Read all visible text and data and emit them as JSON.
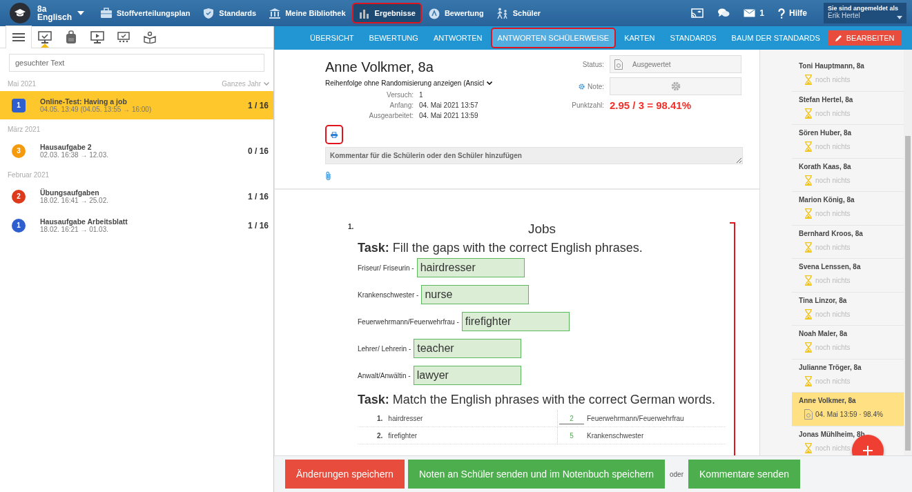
{
  "top_nav": {
    "class_menu": {
      "line1": "8a",
      "line2": "Englisch"
    },
    "items": [
      {
        "label": "Stoffverteilungsplan",
        "selected": false,
        "marked": false
      },
      {
        "label": "Standards",
        "selected": false,
        "marked": false
      },
      {
        "label": "Meine Bibliothek",
        "selected": false,
        "marked": false
      },
      {
        "label": "Ergebnisse",
        "selected": true,
        "marked": true
      },
      {
        "label": "Bewertung",
        "selected": false,
        "marked": false
      },
      {
        "label": "Schüler",
        "selected": false,
        "marked": false
      }
    ],
    "messages_count": "1",
    "help": "Hilfe",
    "user": {
      "caption": "Sie sind angemeldet als",
      "name": "Erik Hertel"
    }
  },
  "left_toolbar": [
    {
      "selected": true,
      "pointer": false
    },
    {
      "selected": false,
      "pointer": true
    },
    {
      "selected": false,
      "pointer": false
    },
    {
      "selected": false,
      "pointer": false
    },
    {
      "selected": false,
      "pointer": false
    },
    {
      "selected": false,
      "pointer": false
    }
  ],
  "search": {
    "placeholder": "gesuchter Text"
  },
  "period_filter": "Ganzes Jahr",
  "groups": [
    {
      "heading": "Mai 2021",
      "items": [
        {
          "badge": "1",
          "color": "#2f5fcf",
          "kind": "square",
          "title": "Online-Test: Having a job",
          "subtitle": "04.05. 13:49 (04.05. 13:55 → 16:00)",
          "count": "1 / 16",
          "selected": true
        }
      ]
    },
    {
      "heading": "März 2021",
      "items": [
        {
          "badge": "3",
          "color": "#f59a0c",
          "kind": "circle",
          "title": "Hausaufgabe 2",
          "subtitle": "02.03. 16:38 → 12.03.",
          "count": "0 / 16",
          "selected": false
        }
      ]
    },
    {
      "heading": "Februar 2021",
      "items": [
        {
          "badge": "2",
          "color": "#dd3a1c",
          "kind": "circle",
          "title": "Übungsaufgaben",
          "subtitle": "18.02. 16:41 → 25.02.",
          "count": "1 / 16",
          "selected": false
        },
        {
          "badge": "1",
          "color": "#2f5fcf",
          "kind": "circle",
          "title": "Hausaufgabe Arbeitsblatt",
          "subtitle": "18.02. 16:21 → 01.03.",
          "count": "1 / 16",
          "selected": false
        }
      ]
    }
  ],
  "sub_nav": {
    "tabs": [
      {
        "label": "ÜBERSICHT",
        "selected": false,
        "marked": false
      },
      {
        "label": "BEWERTUNG",
        "selected": false,
        "marked": false
      },
      {
        "label": "ANTWORTEN",
        "selected": false,
        "marked": false
      },
      {
        "label": "ANTWORTEN SCHÜLERWEISE",
        "selected": true,
        "marked": true
      },
      {
        "label": "KARTEN",
        "selected": false,
        "marked": false
      },
      {
        "label": "STANDARDS",
        "selected": false,
        "marked": false
      },
      {
        "label": "BAUM DER STANDARDS",
        "selected": false,
        "marked": false
      }
    ],
    "edit_button": "BEARBEITEN"
  },
  "result": {
    "student": "Anne Volkmer, 8a",
    "order_select": "Reihenfolge ohne Randomisierung anzeigen (Ansicl",
    "info": [
      {
        "label": "Versuch:",
        "value": "1"
      },
      {
        "label": "Anfang:",
        "value": "04. Mai 2021 13:57"
      },
      {
        "label": "Ausgearbeitet:",
        "value": "04. Mai 2021 13:59"
      }
    ],
    "print_marked": true,
    "status_label": "Status:",
    "status": "Ausgewertet",
    "grade_label": "Note:",
    "score_label": "Punktzahl:",
    "score": "2.95 / 3 = 98.41%",
    "comment_placeholder": "Kommentar für die Schülerin oder den Schüler hinzufügen"
  },
  "question": {
    "number": "1.",
    "title": "Jobs",
    "task1": "**Task:** Fill the gaps with the correct English phrases.",
    "gaps": [
      {
        "label": "Friseur/ Friseurin -",
        "value": "hairdresser"
      },
      {
        "label": "Krankenschwester -",
        "value": "nurse"
      },
      {
        "label": "Feuerwehrmann/Feuerwehrfrau -",
        "value": "firefighter"
      },
      {
        "label": "Lehrer/ Lehrerin -",
        "value": "teacher"
      },
      {
        "label": "Anwalt/Anwältin -",
        "value": "lawyer"
      }
    ],
    "task2": "**Task:** Match the English phrases with the correct German words.",
    "matches": [
      {
        "number": "1.",
        "english": "hairdresser",
        "answer": "2",
        "german": "Feuerwehrmann/Feuerwehrfrau"
      },
      {
        "number": "2.",
        "english": "firefighter",
        "answer": "5",
        "german": "Krankenschwester"
      }
    ]
  },
  "students": [
    {
      "name": "Toni Hauptmann, 8a",
      "status": "noch nichts",
      "kind": "pending",
      "selected": false
    },
    {
      "name": "Stefan Hertel, 8a",
      "status": "noch nichts",
      "kind": "pending",
      "selected": false
    },
    {
      "name": "Sören Huber, 8a",
      "status": "noch nichts",
      "kind": "pending",
      "selected": false
    },
    {
      "name": "Korath Kaas, 8a",
      "status": "noch nichts",
      "kind": "pending",
      "selected": false
    },
    {
      "name": "Marion König, 8a",
      "status": "noch nichts",
      "kind": "pending",
      "selected": false
    },
    {
      "name": "Bernhard Kroos, 8a",
      "status": "noch nichts",
      "kind": "pending",
      "selected": false
    },
    {
      "name": "Svena Lenssen, 8a",
      "status": "noch nichts",
      "kind": "pending",
      "selected": false
    },
    {
      "name": "Tina Linzor, 8a",
      "status": "noch nichts",
      "kind": "pending",
      "selected": false
    },
    {
      "name": "Noah Maler, 8a",
      "status": "noch nichts",
      "kind": "pending",
      "selected": false
    },
    {
      "name": "Julianne Tröger, 8a",
      "status": "noch nichts",
      "kind": "pending",
      "selected": false
    },
    {
      "name": "Anne Volkmer, 8a",
      "status": "04. Mai 13:59 · 98.4%",
      "kind": "done",
      "selected": true
    },
    {
      "name": "Jonas Mühlheim, 8b",
      "status": "noch nichts",
      "kind": "pending",
      "selected": false
    }
  ],
  "footer": {
    "buttons": [
      {
        "label": "Änderungen speichern",
        "kind": "danger"
      },
      {
        "label": "Noten an Schüler senden und im Notenbuch speichern",
        "kind": "success"
      },
      {
        "label": "oder",
        "kind": "text"
      },
      {
        "label": "Kommentare senden",
        "kind": "success"
      }
    ]
  }
}
